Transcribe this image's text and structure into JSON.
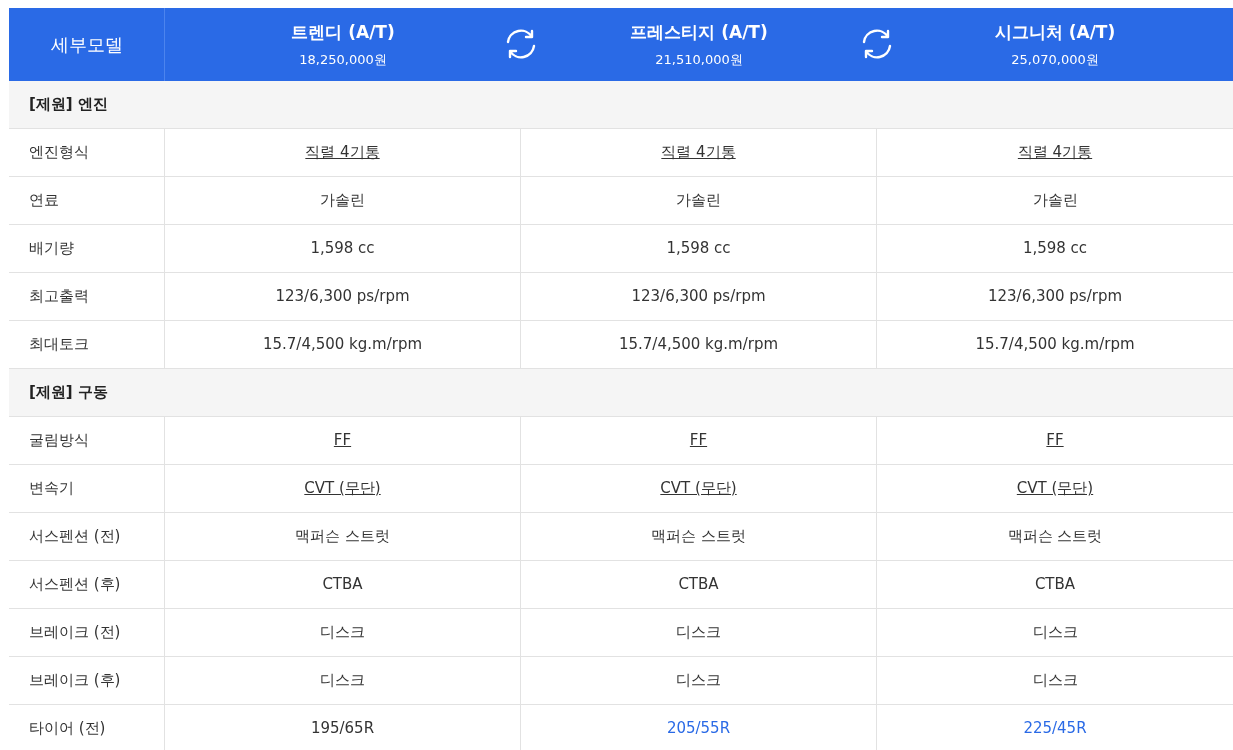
{
  "header": {
    "label": "세부모델",
    "models": [
      {
        "name": "트렌디 (A/T)",
        "price": "18,250,000원"
      },
      {
        "name": "프레스티지 (A/T)",
        "price": "21,510,000원"
      },
      {
        "name": "시그니처 (A/T)",
        "price": "25,070,000원"
      }
    ]
  },
  "sections": [
    {
      "title": "[제원] 엔진",
      "rows": [
        {
          "label": "엔진형식",
          "cells": [
            {
              "text": "직렬 4기통",
              "kind": "link"
            },
            {
              "text": "직렬 4기통",
              "kind": "link"
            },
            {
              "text": "직렬 4기통",
              "kind": "link"
            }
          ]
        },
        {
          "label": "연료",
          "cells": [
            {
              "text": "가솔린",
              "kind": "plain"
            },
            {
              "text": "가솔린",
              "kind": "plain"
            },
            {
              "text": "가솔린",
              "kind": "plain"
            }
          ]
        },
        {
          "label": "배기량",
          "cells": [
            {
              "text": "1,598 cc",
              "kind": "plain"
            },
            {
              "text": "1,598 cc",
              "kind": "plain"
            },
            {
              "text": "1,598 cc",
              "kind": "plain"
            }
          ]
        },
        {
          "label": "최고출력",
          "cells": [
            {
              "text": "123/6,300 ps/rpm",
              "kind": "plain"
            },
            {
              "text": "123/6,300 ps/rpm",
              "kind": "plain"
            },
            {
              "text": "123/6,300 ps/rpm",
              "kind": "plain"
            }
          ]
        },
        {
          "label": "최대토크",
          "cells": [
            {
              "text": "15.7/4,500 kg.m/rpm",
              "kind": "plain"
            },
            {
              "text": "15.7/4,500 kg.m/rpm",
              "kind": "plain"
            },
            {
              "text": "15.7/4,500 kg.m/rpm",
              "kind": "plain"
            }
          ]
        }
      ]
    },
    {
      "title": "[제원] 구동",
      "rows": [
        {
          "label": "굴림방식",
          "cells": [
            {
              "text": "FF",
              "kind": "link"
            },
            {
              "text": "FF",
              "kind": "link"
            },
            {
              "text": "FF",
              "kind": "link"
            }
          ]
        },
        {
          "label": "변속기",
          "cells": [
            {
              "text": "CVT (무단)",
              "kind": "link"
            },
            {
              "text": "CVT (무단)",
              "kind": "link"
            },
            {
              "text": "CVT (무단)",
              "kind": "link"
            }
          ]
        },
        {
          "label": "서스펜션 (전)",
          "cells": [
            {
              "text": "맥퍼슨 스트럿",
              "kind": "plain"
            },
            {
              "text": "맥퍼슨 스트럿",
              "kind": "plain"
            },
            {
              "text": "맥퍼슨 스트럿",
              "kind": "plain"
            }
          ]
        },
        {
          "label": "서스펜션 (후)",
          "cells": [
            {
              "text": "CTBA",
              "kind": "plain"
            },
            {
              "text": "CTBA",
              "kind": "plain"
            },
            {
              "text": "CTBA",
              "kind": "plain"
            }
          ]
        },
        {
          "label": "브레이크 (전)",
          "cells": [
            {
              "text": "디스크",
              "kind": "plain"
            },
            {
              "text": "디스크",
              "kind": "plain"
            },
            {
              "text": "디스크",
              "kind": "plain"
            }
          ]
        },
        {
          "label": "브레이크 (후)",
          "cells": [
            {
              "text": "디스크",
              "kind": "plain"
            },
            {
              "text": "디스크",
              "kind": "plain"
            },
            {
              "text": "디스크",
              "kind": "plain"
            }
          ]
        },
        {
          "label": "타이어 (전)",
          "cells": [
            {
              "text": "195/65R",
              "kind": "plain"
            },
            {
              "text": "205/55R",
              "kind": "highlight"
            },
            {
              "text": "225/45R",
              "kind": "highlight"
            }
          ]
        }
      ]
    }
  ]
}
